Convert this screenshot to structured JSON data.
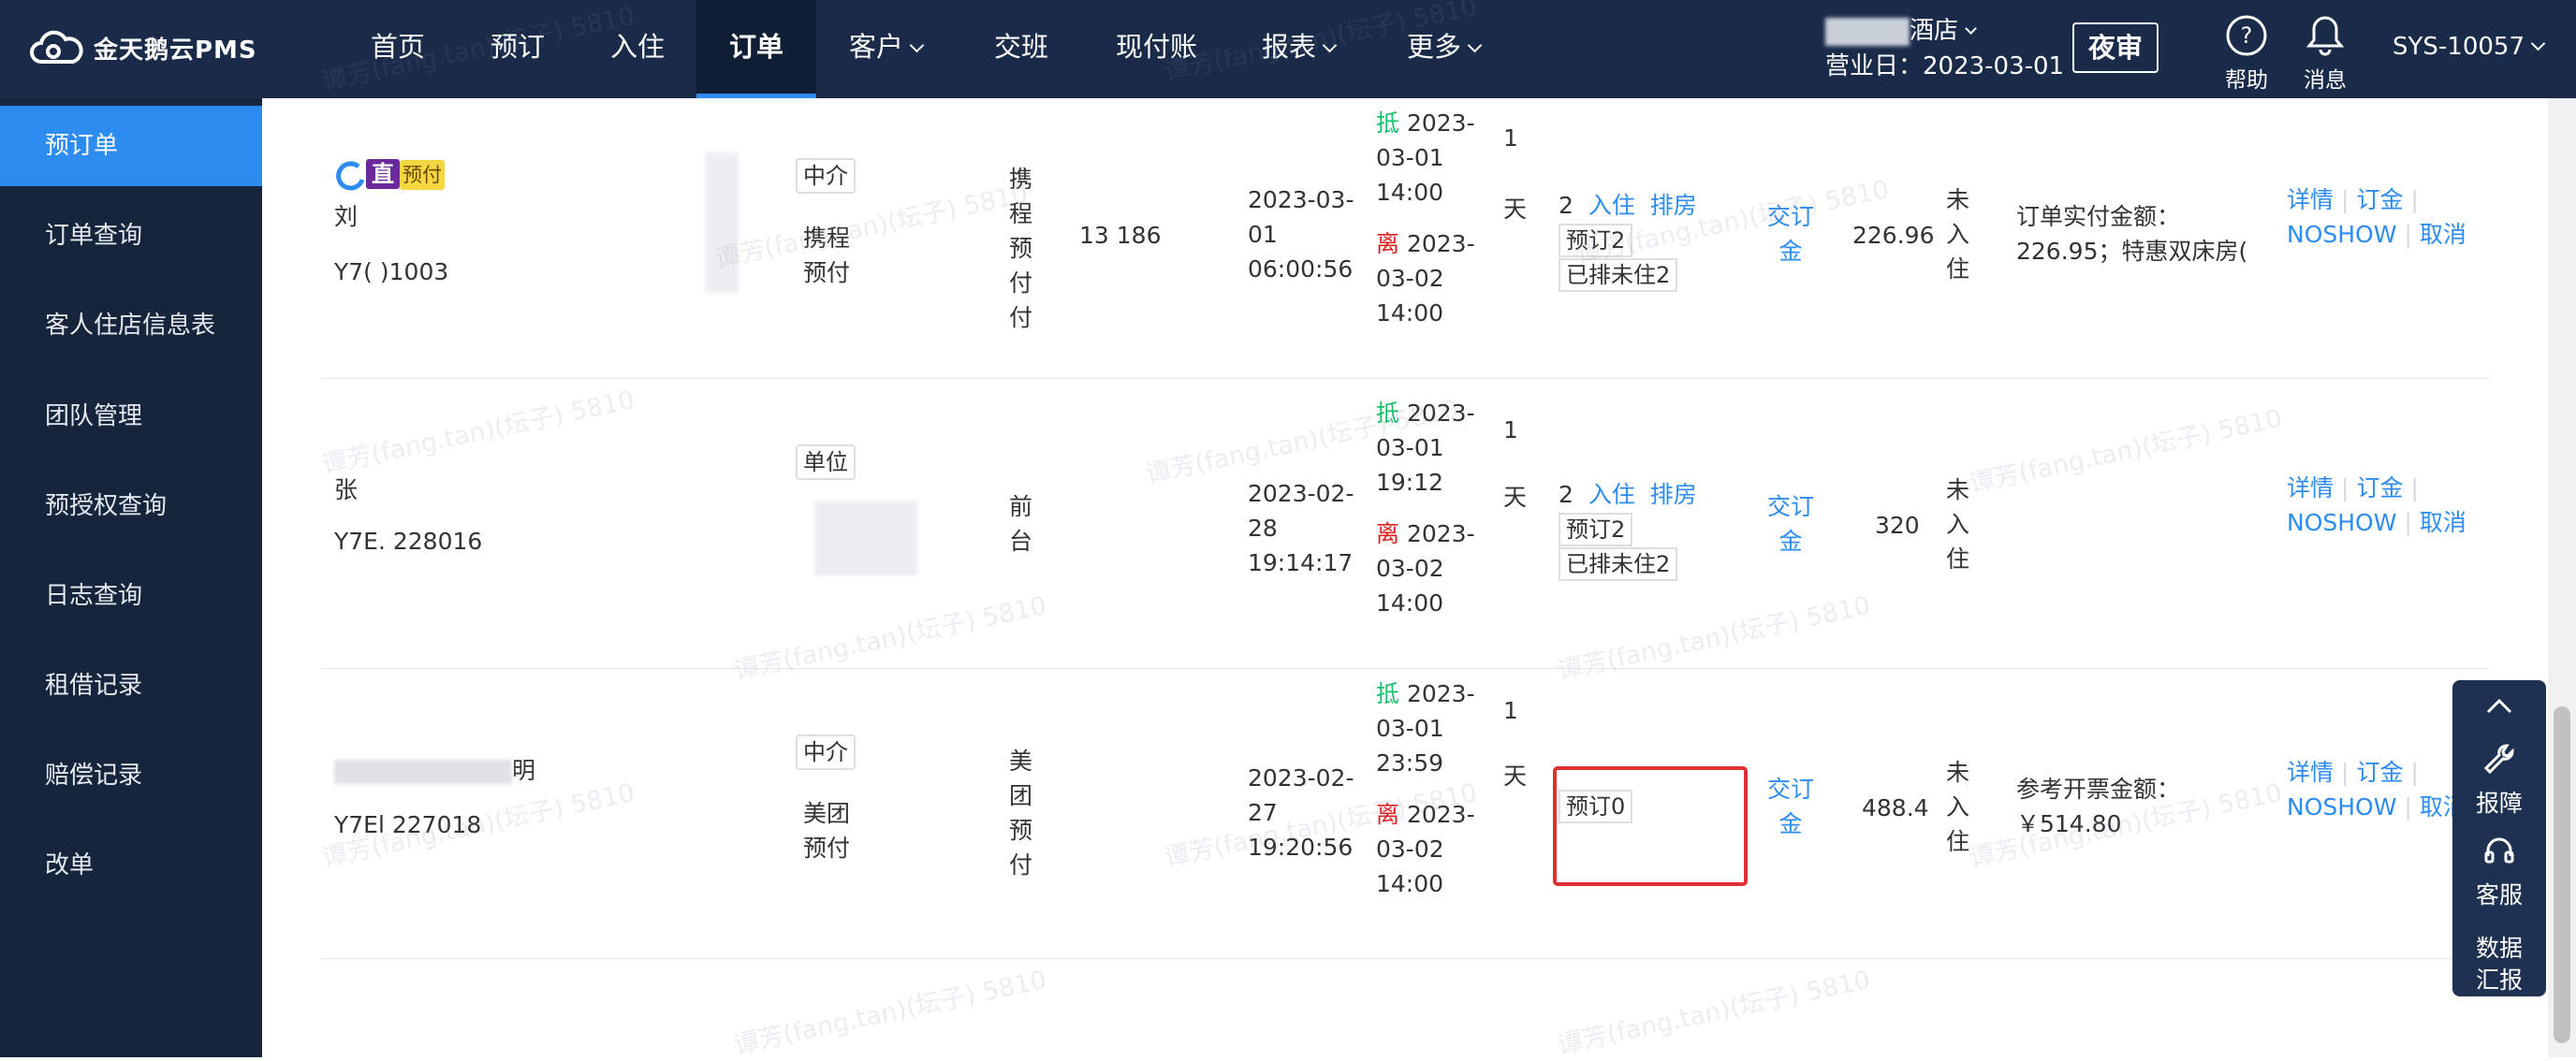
{
  "app": {
    "logo_text": "金天鹅云PMS"
  },
  "nav": {
    "home": "首页",
    "booking": "预订",
    "checkin": "入住",
    "orders": "订单",
    "customer": "客户",
    "shift": "交班",
    "cash": "现付账",
    "reports": "报表",
    "more": "更多"
  },
  "hotel": {
    "name_suffix": "酒店",
    "business_day": "营业日：2023-03-01"
  },
  "night_audit": "夜审",
  "tools": {
    "help": "帮助",
    "message": "消息"
  },
  "account": "SYS-10057",
  "sidebar": {
    "items": [
      {
        "label": "预订单"
      },
      {
        "label": "订单查询"
      },
      {
        "label": "客人住店信息表"
      },
      {
        "label": "团队管理"
      },
      {
        "label": "预授权查询"
      },
      {
        "label": "日志查询"
      },
      {
        "label": "租借记录"
      },
      {
        "label": "赔偿记录"
      },
      {
        "label": "改单"
      }
    ]
  },
  "rows": [
    {
      "badge_direct": "直",
      "badge_prepay": "预付",
      "guest": "刘",
      "order_no": "Y7(      )1003",
      "source_type": "中介",
      "channel": "携程预付",
      "payment": "携程预付付",
      "phone": "13         186",
      "created": [
        "2023-03-",
        "01",
        "06:00:56"
      ],
      "arrive_label": "抵",
      "arrive": [
        "2023-",
        "03-01",
        "14:00"
      ],
      "depart_label": "离",
      "depart": [
        "2023-",
        "03-02",
        "14:00"
      ],
      "nights": "1",
      "nights_unit": "天",
      "rooms": "2",
      "checkin_link": "入住",
      "arrange_link": "排房",
      "tag1": "预订2",
      "tag2": "已排未住2",
      "deposit_link": "交订金",
      "amount": "226.96",
      "status": "未入住",
      "remark": [
        "订单实付金额：",
        "226.95；特惠双床房("
      ],
      "action_detail": "详情",
      "action_deposit": "订金",
      "action_noshow": "NOSHOW",
      "action_cancel": "取消"
    },
    {
      "guest": "张",
      "order_no": "Y7E.       228016",
      "source_type": "单位",
      "payment": "前台",
      "created": [
        "2023-02-",
        "28",
        "19:14:17"
      ],
      "arrive_label": "抵",
      "arrive": [
        "2023-",
        "03-01",
        "19:12"
      ],
      "depart_label": "离",
      "depart": [
        "2023-",
        "03-02",
        "14:00"
      ],
      "nights": "1",
      "nights_unit": "天",
      "rooms": "2",
      "checkin_link": "入住",
      "arrange_link": "排房",
      "tag1": "预订2",
      "tag2": "已排未住2",
      "deposit_link": "交订金",
      "amount": "320",
      "status": "未入住",
      "action_detail": "详情",
      "action_deposit": "订金",
      "action_noshow": "NOSHOW",
      "action_cancel": "取消"
    },
    {
      "guest_suffix": "明",
      "order_no": "Y7El       227018",
      "source_type": "中介",
      "channel": "美团预付",
      "payment": "美团预付",
      "created": [
        "2023-02-",
        "27",
        "19:20:56"
      ],
      "arrive_label": "抵",
      "arrive": [
        "2023-",
        "03-01",
        "23:59"
      ],
      "depart_label": "离",
      "depart": [
        "2023-",
        "03-02",
        "14:00"
      ],
      "nights": "1",
      "nights_unit": "天",
      "tag1": "预订0",
      "deposit_link": "交订金",
      "amount": "488.4",
      "status": "未入住",
      "remark": [
        "参考开票金额：",
        "￥514.80"
      ],
      "action_detail": "详情",
      "action_deposit": "订金",
      "action_noshow": "NOSHOW",
      "action_cancel": "取消"
    }
  ],
  "float_panel": {
    "repair": "报障",
    "service": "客服",
    "report": "数据汇报"
  },
  "watermark": "谭芳(fang.tan)(坛子) 5810",
  "colors": {
    "topbar": "#1a2b4a",
    "sidebar": "#16243c",
    "active": "#2d8cf0",
    "highlight": "#e03030"
  }
}
